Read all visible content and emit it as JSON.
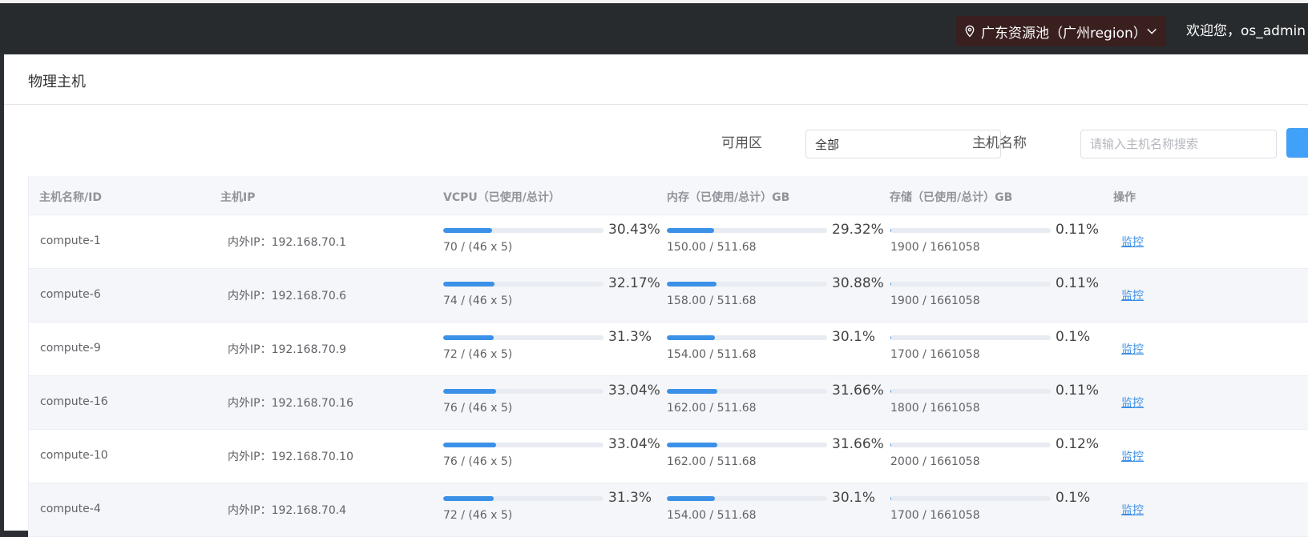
{
  "header": {
    "region_label": "广东资源池（广州region）",
    "welcome": "欢迎您，os_admin"
  },
  "panel": {
    "title": "物理主机"
  },
  "filters": {
    "zone_label": "可用区",
    "zone_value": "全部",
    "host_label": "主机名称",
    "host_placeholder": "请输入主机名称搜索"
  },
  "table": {
    "columns": [
      "主机名称/ID",
      "主机IP",
      "VCPU（已使用/总计）",
      "内存（已使用/总计）GB",
      "存储（已使用/总计）GB",
      "操作"
    ],
    "ip_prefix": "内外IP：",
    "op_label": "监控",
    "rows": [
      {
        "name": "compute-1",
        "ip": "192.168.70.1",
        "vcpu_pct": "30.43%",
        "vcpu_frac": 0.3043,
        "vcpu_used": "70 / (46 x 5)",
        "mem_pct": "29.32%",
        "mem_frac": 0.2932,
        "mem_used": "150.00 / 511.68",
        "sto_pct": "0.11%",
        "sto_frac": 0.0011,
        "sto_used": "1900 / 1661058"
      },
      {
        "name": "compute-6",
        "ip": "192.168.70.6",
        "vcpu_pct": "32.17%",
        "vcpu_frac": 0.3217,
        "vcpu_used": "74 / (46 x 5)",
        "mem_pct": "30.88%",
        "mem_frac": 0.3088,
        "mem_used": "158.00 / 511.68",
        "sto_pct": "0.11%",
        "sto_frac": 0.0011,
        "sto_used": "1900 / 1661058"
      },
      {
        "name": "compute-9",
        "ip": "192.168.70.9",
        "vcpu_pct": "31.3%",
        "vcpu_frac": 0.313,
        "vcpu_used": "72 / (46 x 5)",
        "mem_pct": "30.1%",
        "mem_frac": 0.301,
        "mem_used": "154.00 / 511.68",
        "sto_pct": "0.1%",
        "sto_frac": 0.001,
        "sto_used": "1700 / 1661058"
      },
      {
        "name": "compute-16",
        "ip": "192.168.70.16",
        "vcpu_pct": "33.04%",
        "vcpu_frac": 0.3304,
        "vcpu_used": "76 / (46 x 5)",
        "mem_pct": "31.66%",
        "mem_frac": 0.3166,
        "mem_used": "162.00 / 511.68",
        "sto_pct": "0.11%",
        "sto_frac": 0.0011,
        "sto_used": "1800 / 1661058"
      },
      {
        "name": "compute-10",
        "ip": "192.168.70.10",
        "vcpu_pct": "33.04%",
        "vcpu_frac": 0.3304,
        "vcpu_used": "76 / (46 x 5)",
        "mem_pct": "31.66%",
        "mem_frac": 0.3166,
        "mem_used": "162.00 / 511.68",
        "sto_pct": "0.12%",
        "sto_frac": 0.0012,
        "sto_used": "2000 / 1661058"
      },
      {
        "name": "compute-4",
        "ip": "192.168.70.4",
        "vcpu_pct": "31.3%",
        "vcpu_frac": 0.313,
        "vcpu_used": "72 / (46 x 5)",
        "mem_pct": "30.1%",
        "mem_frac": 0.301,
        "mem_used": "154.00 / 511.68",
        "sto_pct": "0.1%",
        "sto_frac": 0.001,
        "sto_used": "1700 / 1661058"
      }
    ]
  },
  "colors": {
    "accent": "#3b91e8",
    "topbar": "#272b2e",
    "region_bg": "#3a1f1f",
    "track": "#e8ecf2"
  }
}
